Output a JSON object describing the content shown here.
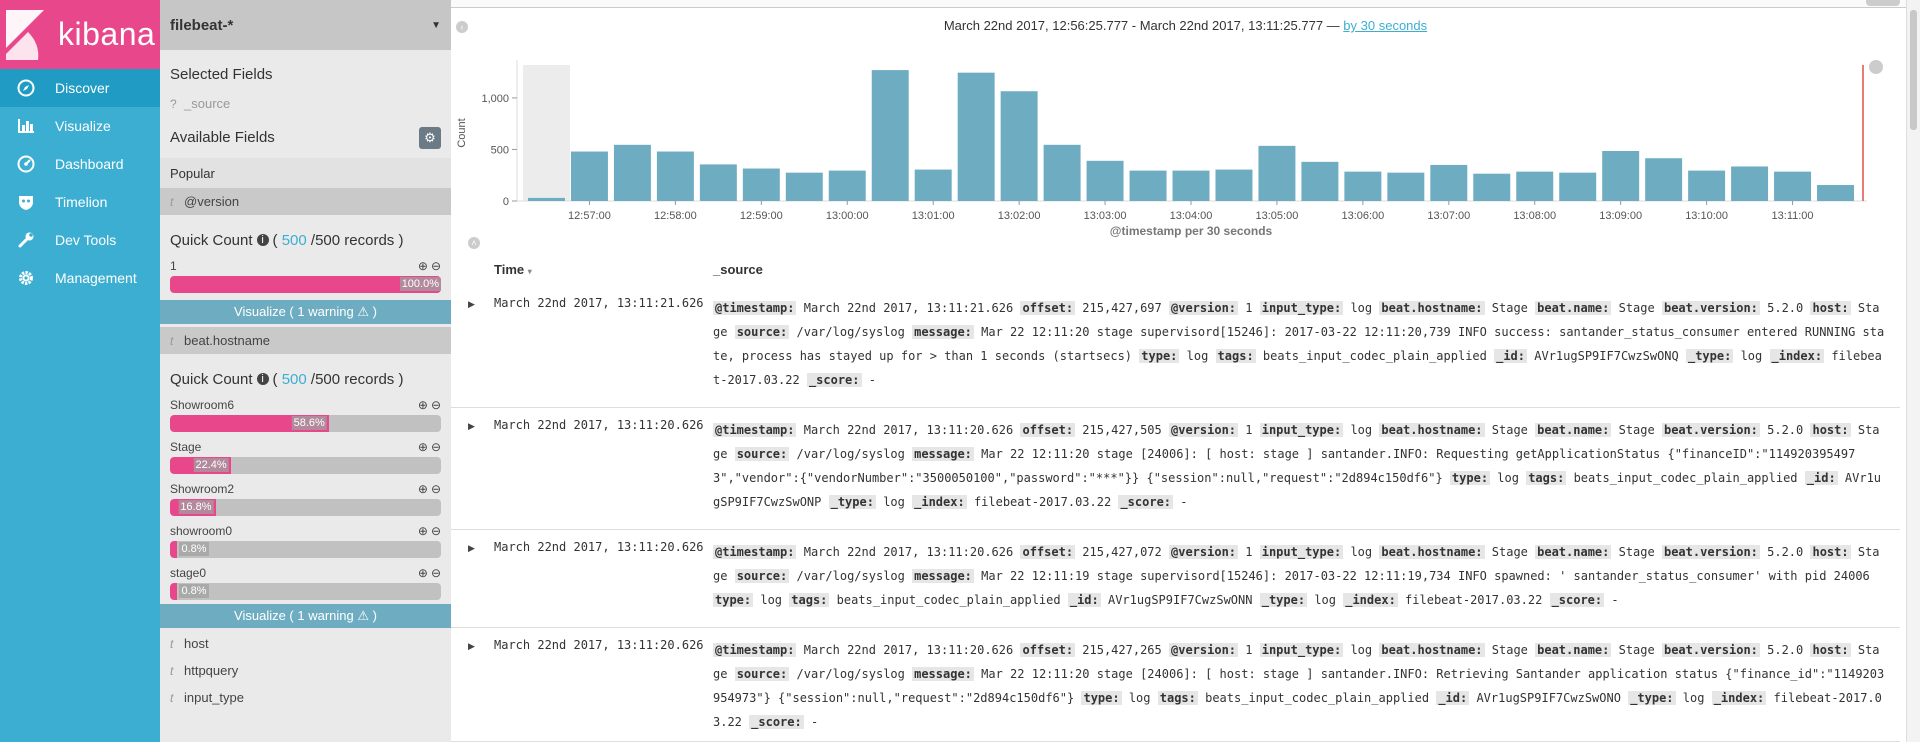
{
  "brand": {
    "name": "kibana"
  },
  "nav": [
    {
      "label": "Discover",
      "icon": "compass-icon",
      "active": true
    },
    {
      "label": "Visualize",
      "icon": "bar-chart-icon",
      "active": false
    },
    {
      "label": "Dashboard",
      "icon": "gauge-icon",
      "active": false
    },
    {
      "label": "Timelion",
      "icon": "shield-icon",
      "active": false
    },
    {
      "label": "Dev Tools",
      "icon": "wrench-icon",
      "active": false
    },
    {
      "label": "Management",
      "icon": "gear-icon",
      "active": false
    }
  ],
  "sidebar": {
    "index_pattern": "filebeat-*",
    "selected_title": "Selected Fields",
    "selected_field": {
      "type": "?",
      "name": "_source"
    },
    "available_title": "Available Fields",
    "popular_title": "Popular",
    "field_version": {
      "type": "t",
      "name": "@version"
    },
    "qc1": {
      "title": "Quick Count",
      "count": "500",
      "total": "/500 records )",
      "open": "(",
      "items": [
        {
          "label": "1",
          "pct": "100.0%",
          "value": 100.0
        }
      ],
      "visualize": "Visualize ( 1 warning ⚠ )"
    },
    "field_hostname": {
      "type": "t",
      "name": "beat.hostname"
    },
    "qc2": {
      "title": "Quick Count",
      "count": "500",
      "total": "/500 records )",
      "open": "(",
      "items": [
        {
          "label": "Showroom6",
          "pct": "58.6%",
          "value": 58.6
        },
        {
          "label": "Stage",
          "pct": "22.4%",
          "value": 22.4
        },
        {
          "label": "Showroom2",
          "pct": "16.8%",
          "value": 16.8
        },
        {
          "label": "showroom0",
          "pct": "0.8%",
          "value": 0.8
        },
        {
          "label": "stage0",
          "pct": "0.8%",
          "value": 0.8
        }
      ],
      "visualize": "Visualize ( 1 warning ⚠ )"
    },
    "more_fields": [
      {
        "type": "t",
        "name": "host"
      },
      {
        "type": "t",
        "name": "httpquery"
      },
      {
        "type": "t",
        "name": "input_type"
      }
    ]
  },
  "main": {
    "time_range": "March 22nd 2017, 12:56:25.777 - March 22nd 2017, 13:11:25.777 —",
    "interval_link": "by 30 seconds",
    "col_time": "Time",
    "col_source": "_source"
  },
  "chart_data": {
    "type": "bar",
    "ylabel": "Count",
    "xlabel": "@timestamp per 30 seconds",
    "ylim": [
      0,
      1300
    ],
    "yticks": [
      "0",
      "500",
      "1,000"
    ],
    "xticks": [
      "12:57:00",
      "12:58:00",
      "12:59:00",
      "13:00:00",
      "13:01:00",
      "13:02:00",
      "13:03:00",
      "13:04:00",
      "13:05:00",
      "13:06:00",
      "13:07:00",
      "13:08:00",
      "13:09:00",
      "13:10:00",
      "13:11:00"
    ],
    "values": [
      30,
      480,
      545,
      480,
      355,
      315,
      275,
      295,
      1270,
      305,
      1245,
      1065,
      545,
      390,
      295,
      295,
      305,
      535,
      380,
      285,
      275,
      350,
      265,
      285,
      275,
      485,
      415,
      295,
      335,
      285,
      155
    ],
    "color": "#6eadc1"
  },
  "docs": [
    {
      "time": "March 22nd 2017, 13:11:21.626",
      "fields": [
        [
          "@timestamp:",
          "March 22nd 2017, 13:11:21.626"
        ],
        [
          "offset:",
          "215,427,697"
        ],
        [
          "@version:",
          "1"
        ],
        [
          "input_type:",
          "log"
        ],
        [
          "beat.hostname:",
          "Stage"
        ],
        [
          "beat.name:",
          "Stage"
        ],
        [
          "beat.version:",
          "5.2.0"
        ],
        [
          "host:",
          "Stage"
        ],
        [
          "source:",
          "/var/log/syslog"
        ],
        [
          "message:",
          "Mar 22 12:11:20 stage supervisord[15246]: 2017-03-22 12:11:20,739 INFO success:        santander_status_consumer entered RUNNING state, process has stayed up for > than 1 seconds (startsecs)"
        ],
        [
          "type:",
          "log"
        ],
        [
          "tags:",
          "beats_input_codec_plain_applied"
        ],
        [
          "_id:",
          "AVr1ugSP9IF7CwzSwONQ"
        ],
        [
          "_type:",
          "log"
        ],
        [
          "_index:",
          "filebeat-2017.03.22"
        ],
        [
          "_score:",
          " -"
        ]
      ]
    },
    {
      "time": "March 22nd 2017, 13:11:20.626",
      "fields": [
        [
          "@timestamp:",
          "March 22nd 2017, 13:11:20.626"
        ],
        [
          "offset:",
          "215,427,505"
        ],
        [
          "@version:",
          "1"
        ],
        [
          "input_type:",
          "log"
        ],
        [
          "beat.hostname:",
          "Stage"
        ],
        [
          "beat.name:",
          "Stage"
        ],
        [
          "beat.version:",
          "5.2.0"
        ],
        [
          "host:",
          "Stage"
        ],
        [
          "source:",
          "/var/log/syslog"
        ],
        [
          "message:",
          "Mar 22 12:11:20 stage [24006]: [        host: stage          ] santander.INFO: Requesting getApplicationStatus {\"financeID\":\"1149203954973\",\"vendor\":{\"vendorNumber\":\"3500050100\",\"password\":\"***\"}} {\"session\":null,\"request\":\"2d894c150df6\"}"
        ],
        [
          "type:",
          "log"
        ],
        [
          "tags:",
          "beats_input_codec_plain_applied"
        ],
        [
          "_id:",
          "AVr1ugSP9IF7CwzSwONP"
        ],
        [
          "_type:",
          "log"
        ],
        [
          "_index:",
          "filebeat-2017.03.22"
        ],
        [
          "_score:",
          " -"
        ]
      ]
    },
    {
      "time": "March 22nd 2017, 13:11:20.626",
      "fields": [
        [
          "@timestamp:",
          "March 22nd 2017, 13:11:20.626"
        ],
        [
          "offset:",
          "215,427,072"
        ],
        [
          "@version:",
          "1"
        ],
        [
          "input_type:",
          "log"
        ],
        [
          "beat.hostname:",
          "Stage"
        ],
        [
          "beat.name:",
          "Stage"
        ],
        [
          "beat.version:",
          "5.2.0"
        ],
        [
          "host:",
          "Stage"
        ],
        [
          "source:",
          "/var/log/syslog"
        ],
        [
          "message:",
          "Mar 22 12:11:19 stage supervisord[15246]: 2017-03-22 12:11:19,734 INFO spawned: '        santander_status_consumer' with pid 24006"
        ],
        [
          "type:",
          "log"
        ],
        [
          "tags:",
          "beats_input_codec_plain_applied"
        ],
        [
          "_id:",
          "AVr1ugSP9IF7CwzSwONN"
        ],
        [
          "_type:",
          "log"
        ],
        [
          "_index:",
          "filebeat-2017.03.22"
        ],
        [
          "_score:",
          " -"
        ]
      ]
    },
    {
      "time": "March 22nd 2017, 13:11:20.626",
      "fields": [
        [
          "@timestamp:",
          "March 22nd 2017, 13:11:20.626"
        ],
        [
          "offset:",
          "215,427,265"
        ],
        [
          "@version:",
          "1"
        ],
        [
          "input_type:",
          "log"
        ],
        [
          "beat.hostname:",
          "Stage"
        ],
        [
          "beat.name:",
          "Stage"
        ],
        [
          "beat.version:",
          "5.2.0"
        ],
        [
          "host:",
          "Stage"
        ],
        [
          "source:",
          "/var/log/syslog"
        ],
        [
          "message:",
          "Mar 22 12:11:20 stage [24006]: [        host: stage          ] santander.INFO: Retrieving Santander application status {\"finance_id\":\"1149203954973\"} {\"session\":null,\"request\":\"2d894c150df6\"}"
        ],
        [
          "type:",
          "log"
        ],
        [
          "tags:",
          "beats_input_codec_plain_applied"
        ],
        [
          "_id:",
          "AVr1ugSP9IF7CwzSwONO"
        ],
        [
          "_type:",
          "log"
        ],
        [
          "_index:",
          "filebeat-2017.03.22"
        ],
        [
          "_score:",
          " -"
        ]
      ]
    }
  ]
}
